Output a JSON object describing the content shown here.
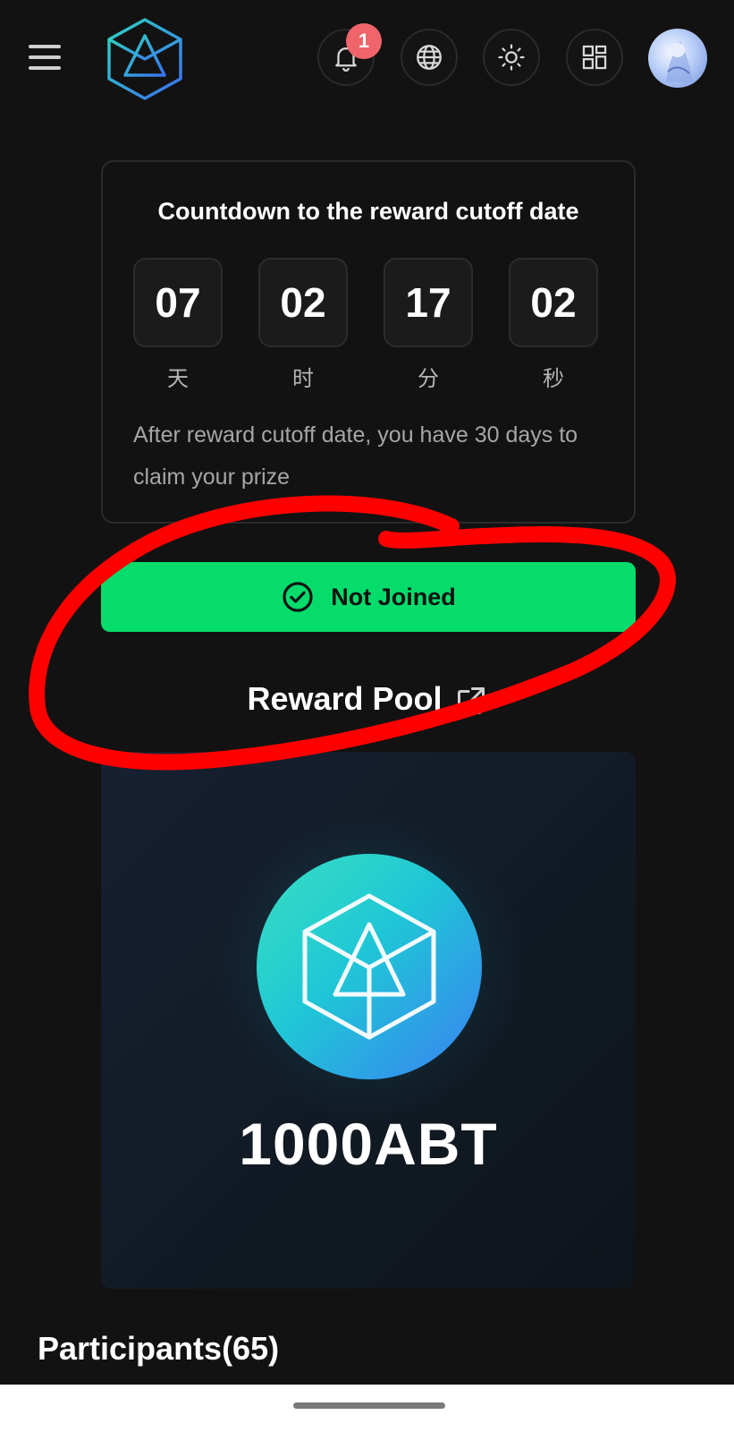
{
  "header": {
    "notification_count": "1",
    "icons": [
      "menu-icon",
      "app-logo-icon",
      "bell-icon",
      "globe-icon",
      "sun-icon",
      "grid-icon",
      "avatar"
    ]
  },
  "countdown": {
    "title": "Countdown to the reward cutoff date",
    "units": [
      {
        "value": "07",
        "label": "天"
      },
      {
        "value": "02",
        "label": "时"
      },
      {
        "value": "17",
        "label": "分"
      },
      {
        "value": "02",
        "label": "秒"
      }
    ],
    "note": "After reward cutoff date, you have 30 days to claim your prize"
  },
  "join_button": {
    "label": "Not Joined",
    "color": "#05dc6b"
  },
  "reward_pool": {
    "title": "Reward Pool",
    "amount": "1000ABT"
  },
  "participants": {
    "label": "Participants(65)"
  },
  "colors": {
    "background": "#121212",
    "accent_green": "#05dc6b",
    "badge_red": "#f0646b",
    "annotation_red": "#ff0000"
  }
}
